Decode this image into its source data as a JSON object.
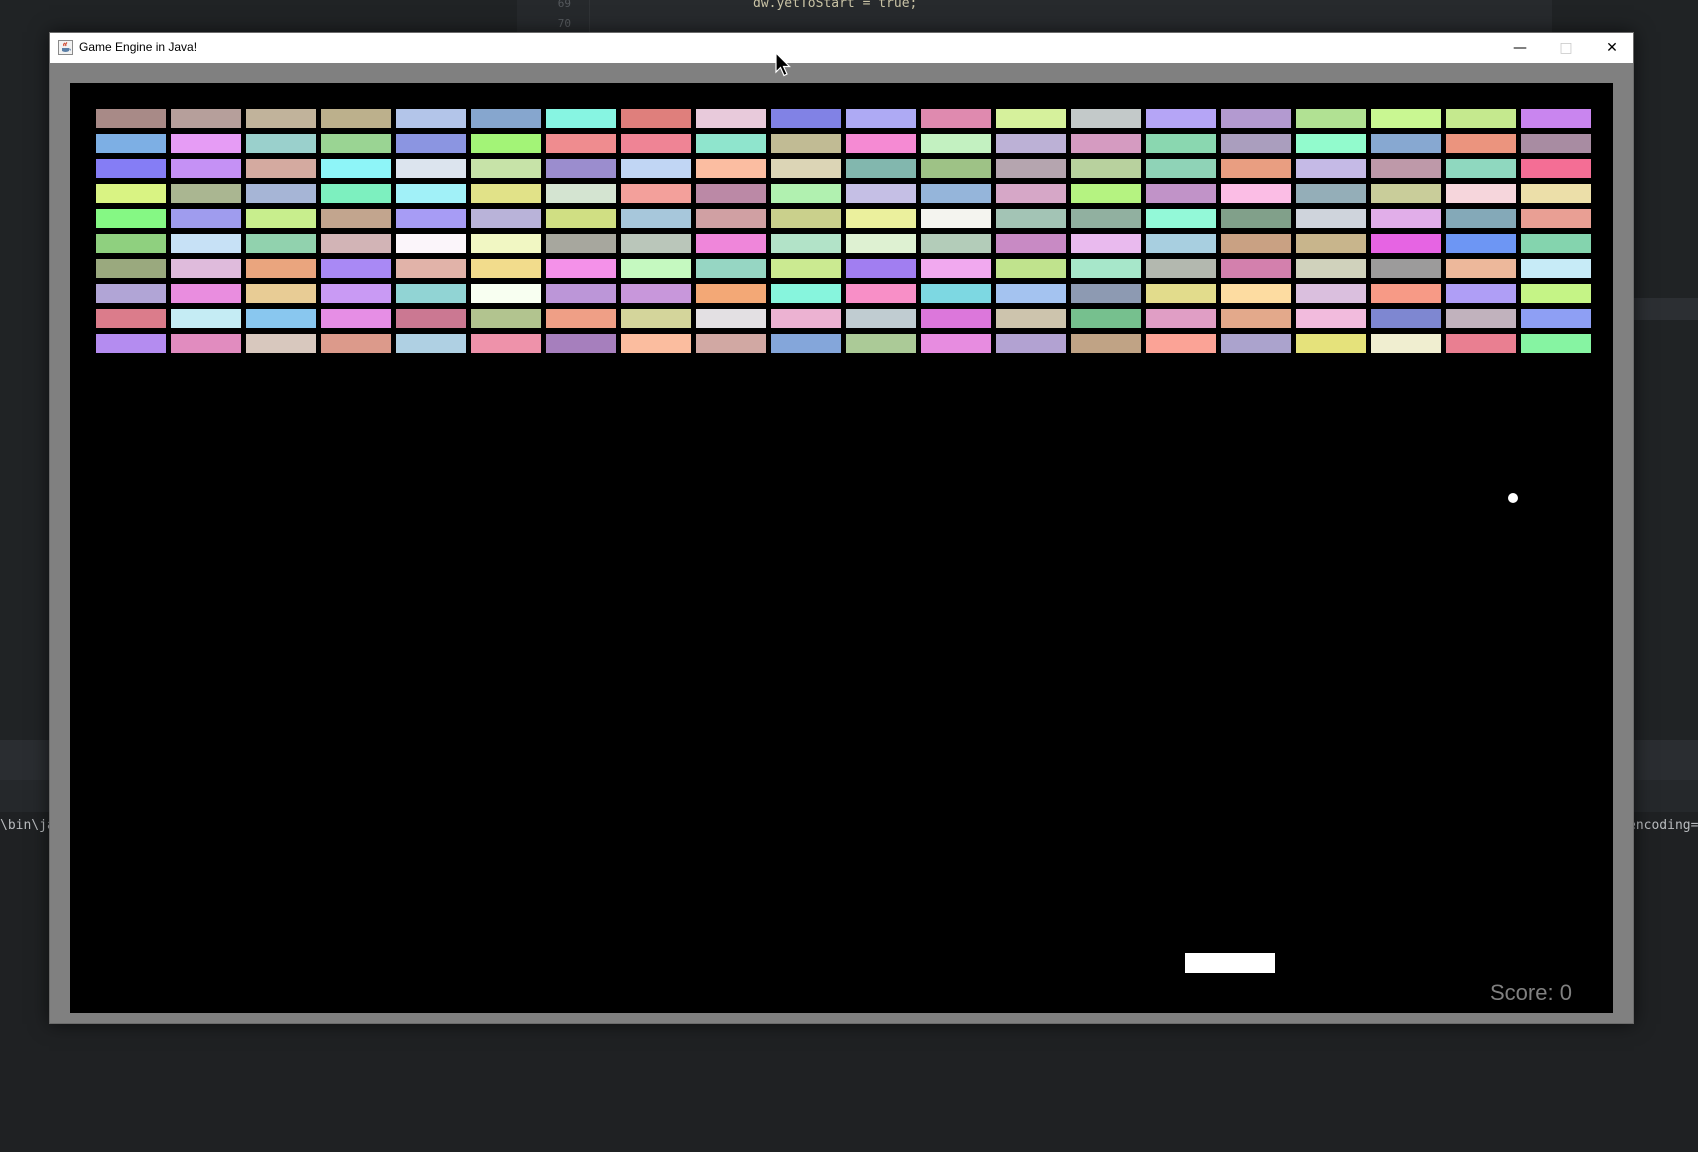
{
  "ide": {
    "line_numbers": [
      "69",
      "70"
    ],
    "code_line": "dw.yetToStart = true;",
    "console_left": "\\bin\\ja",
    "console_right": "encoding="
  },
  "window": {
    "title": "Game Engine in Java!",
    "minimize_glyph": "—",
    "maximize_glyph": "□",
    "close_glyph": "✕"
  },
  "game": {
    "score_label": "Score: 0",
    "score": 0,
    "brick_colors": [
      [
        "#a88a87",
        "#b69f9b",
        "#c1b39b",
        "#bcb08c",
        "#b3c5e9",
        "#86a6ce",
        "#87f5e2",
        "#df7f7c",
        "#e8cadb",
        "#8182e5",
        "#aeaaf4",
        "#df8aaf",
        "#d6f19c",
        "#c3c9c9",
        "#b5a5f6",
        "#b39ad0",
        "#b1e193",
        "#c9f792",
        "#c5e98e",
        "#c985ef"
      ],
      [
        "#7dafe4",
        "#e69cf5",
        "#9ad0cc",
        "#9ad493",
        "#8b95e1",
        "#a3f477",
        "#ef8c8f",
        "#ef8495",
        "#8fe5cd",
        "#c1bb94",
        "#f58ad3",
        "#c3f1c1",
        "#bcb1d6",
        "#d59bc1",
        "#8ad7b0",
        "#aa9ebe",
        "#92fbcd",
        "#87a8d1",
        "#eb947e",
        "#a88ca2"
      ],
      [
        "#857df5",
        "#c591f5",
        "#d4aaa0",
        "#8ef5f8",
        "#dce4ee",
        "#c7e3a8",
        "#9b8dce",
        "#c1d6f4",
        "#fbbda1",
        "#dcd5b6",
        "#82b7ae",
        "#9ec286",
        "#b5a5af",
        "#b8d19e",
        "#8fd3b7",
        "#e99e81",
        "#c5bae6",
        "#be99a9",
        "#8fd8bf",
        "#f46e95"
      ],
      [
        "#d9f383",
        "#aab691",
        "#a6b5d6",
        "#7df0bf",
        "#a1f1f8",
        "#e1e288",
        "#d4e4d1",
        "#f3a09b",
        "#bb89a6",
        "#b1f1b0",
        "#c5bfe5",
        "#95b5da",
        "#d6a7c7",
        "#b5f381",
        "#c193c8",
        "#fbbde5",
        "#94aeb8",
        "#c9cd9a",
        "#f6d6dc",
        "#ecdfa9"
      ],
      [
        "#85f884",
        "#9f9cee",
        "#c8ee8d",
        "#c2a58e",
        "#a79cf5",
        "#b9b3d9",
        "#d0df83",
        "#a7c7db",
        "#d0a0a3",
        "#cad08c",
        "#ebf09d",
        "#f4f4ef",
        "#a3c4b5",
        "#91b0a0",
        "#93f9d8",
        "#81a08a",
        "#cfd4dc",
        "#e1aee9",
        "#84a9b8",
        "#e99f94"
      ],
      [
        "#8fd07f",
        "#c7e1f6",
        "#91d2ae",
        "#d2b4b6",
        "#fbf5fa",
        "#f1f7c3",
        "#a7a79e",
        "#bac6ba",
        "#ef86da",
        "#b2e3c8",
        "#def1d2",
        "#b3ccb9",
        "#c88ac4",
        "#e9baee",
        "#a8cfe0",
        "#c9a183",
        "#c8b58c",
        "#e664e3",
        "#6d96f4",
        "#84d4ae"
      ],
      [
        "#9aa97e",
        "#dfbbdc",
        "#eaa57e",
        "#a989f5",
        "#e1b3a9",
        "#f2dc8c",
        "#f491e9",
        "#c5f9c0",
        "#96d6c3",
        "#cbea91",
        "#a17ef1",
        "#f1a9ef",
        "#c0e38d",
        "#a7e7ca",
        "#b3b8af",
        "#d380ad",
        "#d0d2bc",
        "#9c9b9b",
        "#edb89b",
        "#c7ebf7"
      ],
      [
        "#b1a5d6",
        "#e98ddf",
        "#e8cc95",
        "#c99af4",
        "#91d4d4",
        "#f8fff1",
        "#bc96d8",
        "#c897db",
        "#f3a876",
        "#87f5dd",
        "#f88fc7",
        "#7dd8e2",
        "#a4c3f0",
        "#8d9ab2",
        "#e2dc8c",
        "#fddca1",
        "#dabfde",
        "#f79a86",
        "#af9ef6",
        "#c5f486"
      ],
      [
        "#db7c8b",
        "#c5ecf4",
        "#89c7ef",
        "#e68ee5",
        "#cb7892",
        "#b2c48f",
        "#ef9f86",
        "#d4d59b",
        "#e3e0e3",
        "#ecb2d2",
        "#c0ccd1",
        "#dc77db",
        "#cdc4ad",
        "#76c08e",
        "#e09ec5",
        "#e3a98b",
        "#f2bbdd",
        "#7e87d1",
        "#c1b2bd",
        "#8e9ff4"
      ],
      [
        "#b48cf0",
        "#e18cbf",
        "#d8c8be",
        "#dc9a8b",
        "#afd0e3",
        "#ee92aa",
        "#a67fbd",
        "#fbbd9f",
        "#d1a8a3",
        "#84a6da",
        "#abca97",
        "#e78ce0",
        "#b2a2d2",
        "#c0a385",
        "#fba396",
        "#aba3cd",
        "#e5e27b",
        "#f0eed0",
        "#e97f91",
        "#86f4a2"
      ]
    ]
  }
}
